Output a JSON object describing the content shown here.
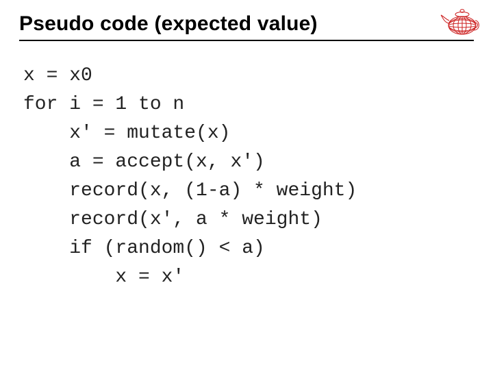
{
  "header": {
    "title": "Pseudo code (expected value)"
  },
  "code": {
    "lines": [
      "x = x0",
      "for i = 1 to n",
      "    x' = mutate(x)",
      "    a = accept(x, x')",
      "    record(x, (1-a) * weight)",
      "    record(x', a * weight)",
      "    if (random() < a)",
      "        x = x'"
    ]
  },
  "logo": {
    "name": "teapot-wireframe-logo",
    "stroke": "#cc1f1f"
  }
}
